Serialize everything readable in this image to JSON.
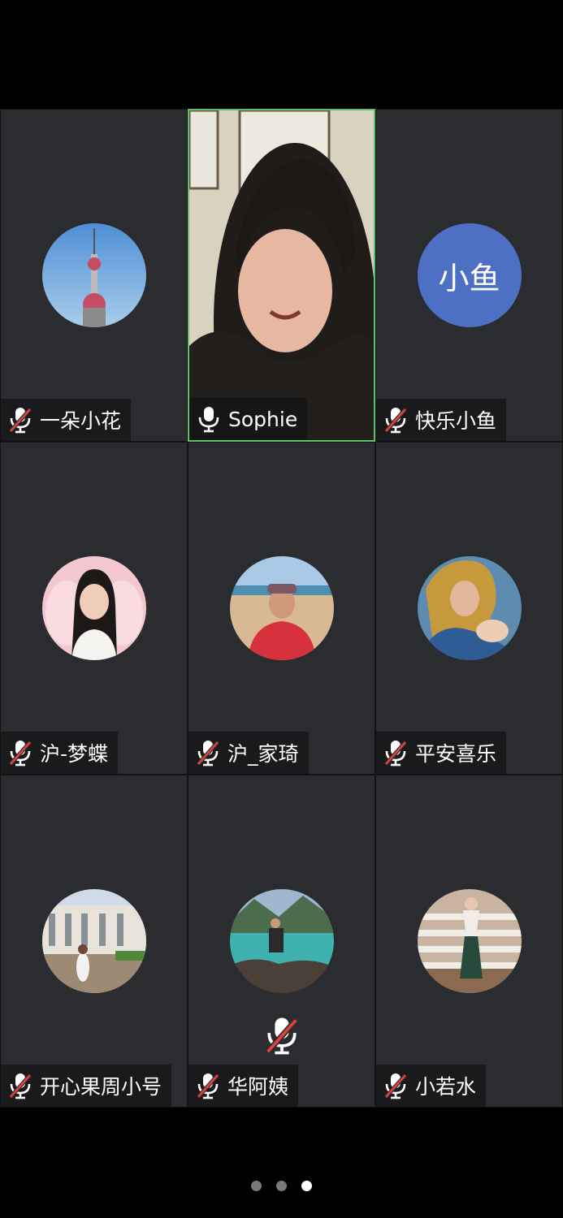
{
  "participants": [
    {
      "name": "一朵小花",
      "muted": true,
      "avatar": "tower-photo"
    },
    {
      "name": "Sophie",
      "muted": false,
      "avatar": "live-video",
      "active": true
    },
    {
      "name": "快乐小鱼",
      "muted": true,
      "avatar_text": "小鱼",
      "avatar_color": "#4d6fc4"
    },
    {
      "name": "沪-梦蝶",
      "muted": true,
      "avatar": "portrait-photo"
    },
    {
      "name": "沪_家琦",
      "muted": true,
      "avatar": "beach-photo"
    },
    {
      "name": "平安喜乐",
      "muted": true,
      "avatar": "painting-photo"
    },
    {
      "name": "开心果周小号",
      "muted": true,
      "avatar": "building-photo"
    },
    {
      "name": "华阿姨",
      "muted": true,
      "avatar": "lake-photo",
      "speaking_indicator": "muted-mic-icon"
    },
    {
      "name": "小若水",
      "muted": true,
      "avatar": "fence-photo"
    }
  ],
  "pagination": {
    "pages": 3,
    "current": 3
  },
  "colors": {
    "tile_bg": "#2b2c30",
    "active_border": "#5cc36a",
    "muted_slash": "#e0413a"
  }
}
